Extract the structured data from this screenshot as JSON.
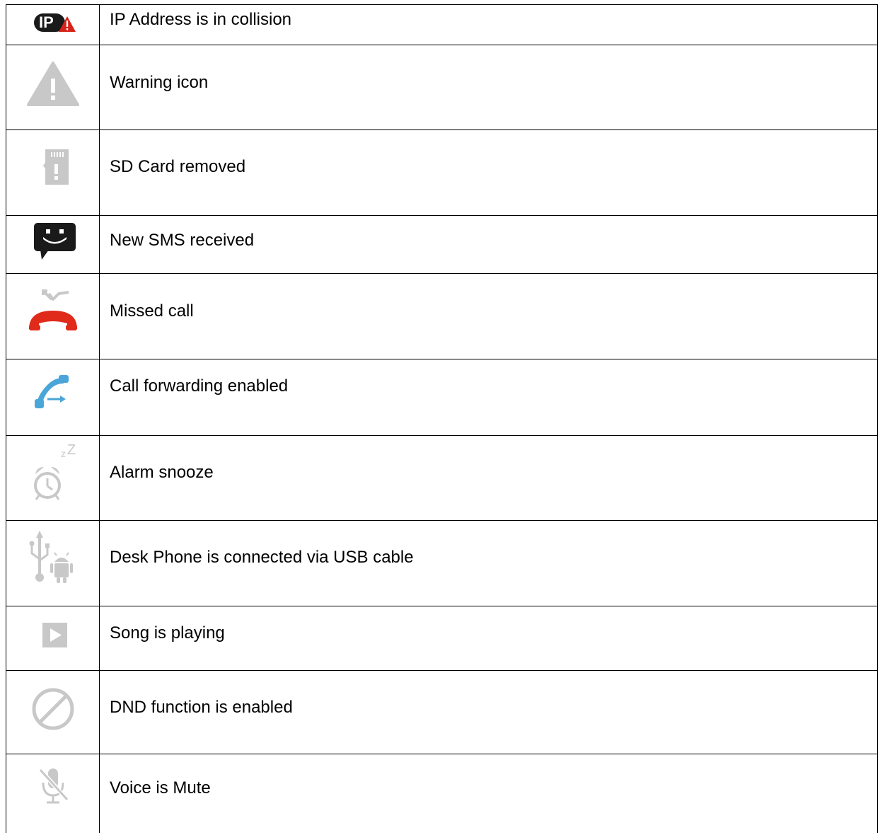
{
  "rows": [
    {
      "icon": "ip-collision-icon",
      "label": "IP Address is in collision"
    },
    {
      "icon": "warning-icon",
      "label": "Warning icon"
    },
    {
      "icon": "sd-card-removed-icon",
      "label": "SD Card removed"
    },
    {
      "icon": "new-sms-icon",
      "label": "New SMS received"
    },
    {
      "icon": "missed-call-icon",
      "label": "Missed call"
    },
    {
      "icon": "call-forwarding-icon",
      "label": "Call forwarding enabled"
    },
    {
      "icon": "alarm-snooze-icon",
      "label": "Alarm snooze"
    },
    {
      "icon": "usb-connected-icon",
      "label": "Desk Phone is connected via USB cable"
    },
    {
      "icon": "song-playing-icon",
      "label": "Song is playing"
    },
    {
      "icon": "dnd-icon",
      "label": "DND function is enabled"
    },
    {
      "icon": "voice-mute-icon",
      "label": "Voice is Mute"
    }
  ],
  "colors": {
    "border": "#000000",
    "icon_gray": "#c8c8c8",
    "icon_dark": "#1a1a1a",
    "missed_call_red": "#e02a1a",
    "forward_blue": "#4aa6d8",
    "alert_red": "#d8231a"
  }
}
